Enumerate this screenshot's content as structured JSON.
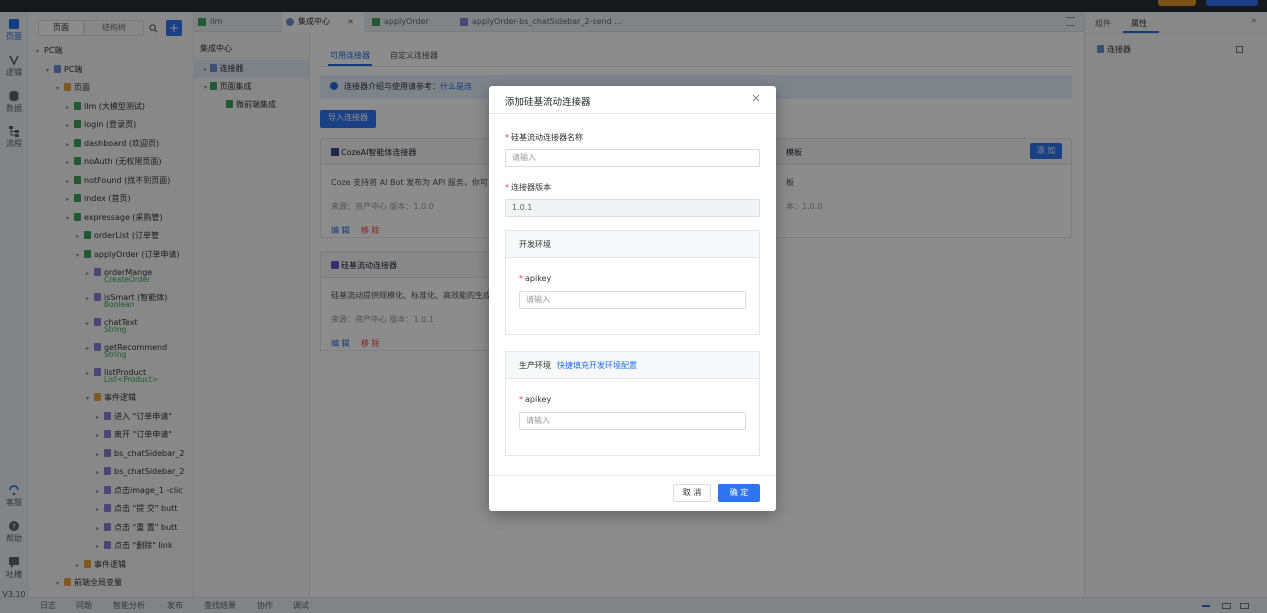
{
  "left_rail": {
    "items": [
      {
        "label": "页面",
        "icon": "page-icon"
      },
      {
        "label": "逻辑",
        "icon": "logic-icon"
      },
      {
        "label": "数据",
        "icon": "database-icon"
      },
      {
        "label": "流程",
        "icon": "flow-icon"
      }
    ],
    "bottom_items": [
      {
        "label": "客服",
        "icon": "support-icon"
      },
      {
        "label": "帮助",
        "icon": "help-icon"
      },
      {
        "label": "吐槽",
        "icon": "feedback-icon"
      }
    ],
    "version": "V3.10"
  },
  "tree_panel": {
    "segments": [
      "页面",
      "结构树"
    ],
    "nodes": [
      {
        "label": "PC端",
        "level": 0
      },
      {
        "label": "PC端",
        "level": 1
      },
      {
        "label": "页面",
        "level": 2
      },
      {
        "label": "llm (大模型测试)",
        "level": 3
      },
      {
        "label": "login (登录页)",
        "level": 3
      },
      {
        "label": "dashboard (欢迎页)",
        "level": 3
      },
      {
        "label": "noAuth (无权限页面)",
        "level": 3
      },
      {
        "label": "notFound (找不到页面)",
        "level": 3
      },
      {
        "label": "index (首页)",
        "level": 3
      },
      {
        "label": "expressage (采购管)",
        "level": 3
      },
      {
        "label": "orderList (订单管",
        "level": 4
      },
      {
        "label": "applyOrder (订单申请)",
        "level": 4
      },
      {
        "label": "orderMange",
        "sub": "CreateOrder",
        "level": 5
      },
      {
        "label": "isSmart (智能体)",
        "sub": "Boolean",
        "level": 5
      },
      {
        "label": "chatText",
        "sub": "String",
        "level": 5
      },
      {
        "label": "getRecommend",
        "sub": "String",
        "level": 5
      },
      {
        "label": "listProduct",
        "sub": "List<Product>",
        "level": 5
      },
      {
        "label": "事件逻辑",
        "level": 5
      },
      {
        "label": "进入 \"订单申请\"",
        "level": 6
      },
      {
        "label": "离开 \"订单申请\"",
        "level": 6
      },
      {
        "label": "bs_chatSidebar_2",
        "level": 6
      },
      {
        "label": "bs_chatSidebar_2",
        "level": 6
      },
      {
        "label": "点击image_1 -clic",
        "level": 6
      },
      {
        "label": "点击 \"提 交\" butt",
        "level": 6
      },
      {
        "label": "点击 \"重 置\" butt",
        "level": 6
      },
      {
        "label": "点击 \"删除\" link",
        "level": 6
      },
      {
        "label": "事件逻辑",
        "level": 4
      },
      {
        "label": "前端全局变量",
        "level": 2
      }
    ]
  },
  "tabs": [
    {
      "label": "llm"
    },
    {
      "label": "集成中心"
    },
    {
      "label": "applyOrder"
    },
    {
      "label": "applyOrder-bs_chatSidebar_2-send ..."
    }
  ],
  "integration_nav": {
    "title": "集成中心",
    "items": [
      "连接器",
      "页面集成",
      "微前端集成"
    ]
  },
  "main": {
    "subtabs": [
      "可用连接器",
      "自定义连接器"
    ],
    "notice": "连接器介绍与使用请参考：",
    "notice_link": "什么是连",
    "import_button": "导入连接器",
    "cards": [
      {
        "title": "CozeAI智能体连接器",
        "desc": "Coze 支持将 AI Bot 发布为 API 服务，你可以",
        "meta": "来源：资产中心  版本：1.0.0",
        "edit": "编 辑",
        "remove": "移 除"
      },
      {
        "title": "硅基流动连接器",
        "desc": "硅基流动提供规模化、标准化、高效能的生成",
        "meta": "来源：资产中心  版本：1.0.1",
        "edit": "编 辑",
        "remove": "移 除"
      }
    ],
    "right_card": {
      "title": "模板",
      "desc": "板",
      "meta": "本：1.0.0",
      "add_button": "添 加"
    }
  },
  "right_panel": {
    "tabs": [
      "组件",
      "属性"
    ],
    "section": "连接器"
  },
  "bottom_bar": {
    "items": [
      "日志",
      "问题",
      "智能分析",
      "发布",
      "查找结果",
      "协作",
      "调试"
    ]
  },
  "modal": {
    "title": "添加硅基流动连接器",
    "name_label": "硅基流动连接器名称",
    "name_placeholder": "请输入",
    "version_label": "连接器版本",
    "version_value": "1.0.1",
    "dev_env": {
      "title": "开发环境",
      "field_label": "apikey",
      "placeholder": "请输入"
    },
    "prod_env": {
      "title": "生产环境",
      "link": "快捷填充开发环境配置",
      "field_label": "apikey",
      "placeholder": "请输入"
    },
    "cancel": "取 消",
    "confirm": "确 定"
  },
  "colors": {
    "accent": "#1f6fe5",
    "required": "#f53f3f"
  }
}
